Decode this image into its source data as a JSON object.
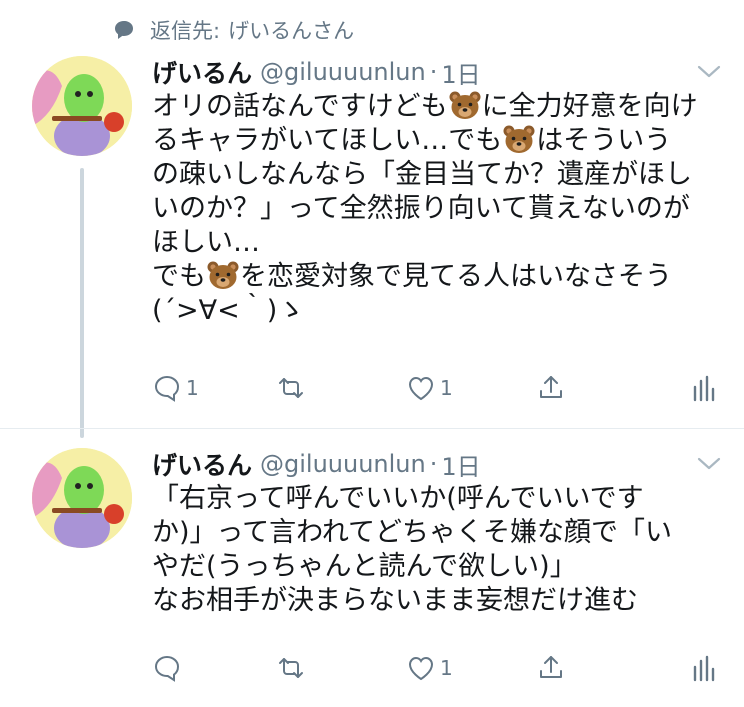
{
  "reply_context": {
    "prefix": "返信先:",
    "target": "げいるんさん"
  },
  "tweets": [
    {
      "name": "げいるん",
      "handle": "@giluuuunlun",
      "dot": "·",
      "time": "1日",
      "lines": [
        [
          "オリの話なんですけども",
          "bear-emoji",
          "に全力好意を向け"
        ],
        [
          "るキャラがいてほしい…でも",
          "bear-emoji",
          "はそういう"
        ],
        [
          "の疎いしなんなら「金目当てか？遺産がほし"
        ],
        [
          "いのか？」って全然振り向いて貰えないのが"
        ],
        [
          "ほしい…"
        ],
        [
          "でも",
          "bear-emoji",
          "を恋愛対象で見てる人はいなさそう"
        ],
        [
          "(´>∀<｀)ゝ"
        ]
      ],
      "reply_count": "1",
      "retweet_count": "",
      "like_count": "1"
    },
    {
      "name": "げいるん",
      "handle": "@giluuuunlun",
      "dot": "·",
      "time": "1日",
      "lines": [
        [
          "「右京って呼んでいいか(呼んでいいです"
        ],
        [
          "か)」って言われてどちゃくそ嫌な顔で「い"
        ],
        [
          "やだ(うっちゃんと読んで欲しい)」"
        ],
        [
          "なお相手が決まらないまま妄想だけ進む"
        ]
      ],
      "reply_count": "",
      "retweet_count": "",
      "like_count": "1"
    }
  ],
  "colors": {
    "text": "#14171a",
    "secondary": "#657786",
    "thread_line": "#ccd6dd",
    "avatar_bg": "#f6efa6"
  },
  "icons": [
    "speech-bubble-icon",
    "chevron-down-icon",
    "reply-icon",
    "retweet-icon",
    "heart-icon",
    "share-icon",
    "stats-icon",
    "bear-emoji"
  ]
}
